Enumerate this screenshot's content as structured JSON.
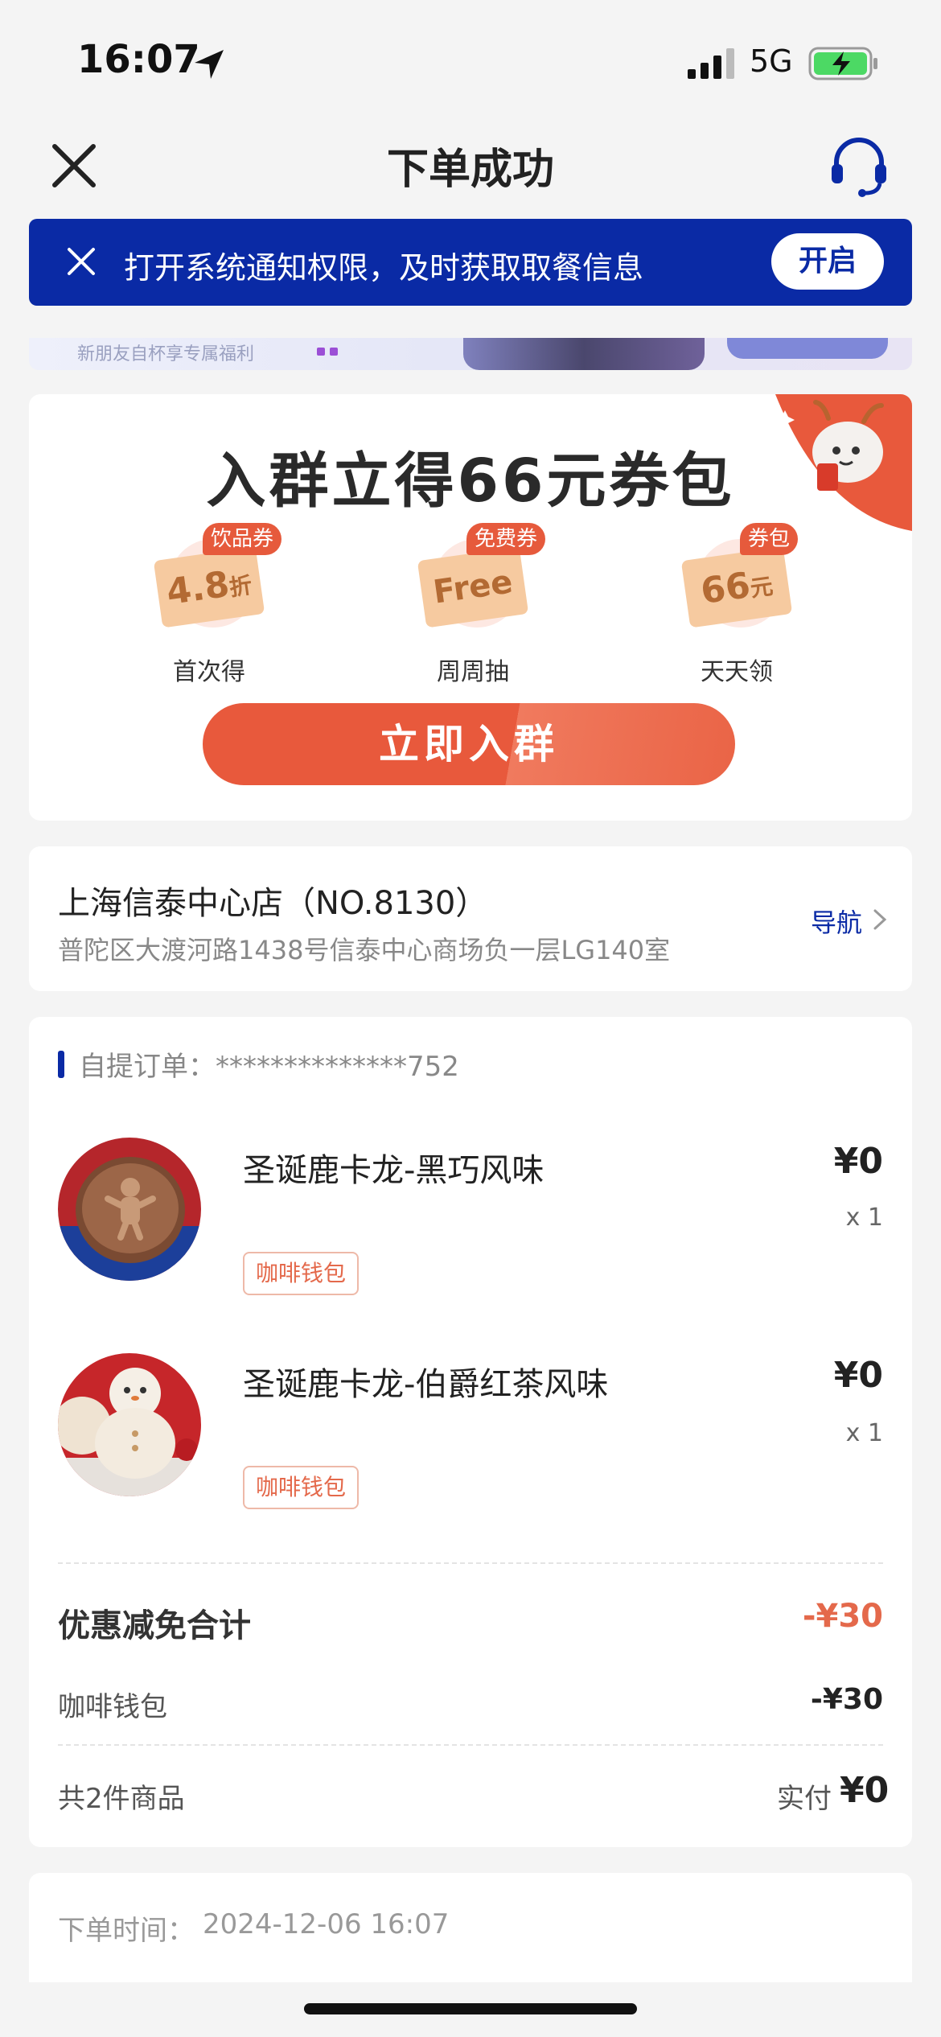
{
  "status": {
    "time": "16:07",
    "network": "5G"
  },
  "header": {
    "title": "下单成功"
  },
  "notice": {
    "text": "打开系统通知权限，及时获取取餐信息",
    "button": "开启"
  },
  "peek_banner": {
    "text": "新朋友自杯享专属福利"
  },
  "group": {
    "title": "入群立得66元券包",
    "coupons": [
      {
        "badge": "饮品券",
        "ticket_main": "4.8",
        "ticket_sub": "折",
        "label": "首次得"
      },
      {
        "badge": "免费券",
        "ticket_main": "Free",
        "ticket_sub": "",
        "label": "周周抽"
      },
      {
        "badge": "券包",
        "ticket_main": "66",
        "ticket_sub": "元",
        "label": "天天领"
      }
    ],
    "join_button": "立即入群"
  },
  "store": {
    "name": "上海信泰中心店（NO.8130）",
    "address": "普陀区大渡河路1438号信泰中心商场负一层LG140室",
    "nav_label": "导航"
  },
  "order": {
    "id_label": "自提订单：",
    "id_value": "**************752",
    "items": [
      {
        "name": "圣诞鹿卡龙-黑巧风味",
        "tag": "咖啡钱包",
        "price": "¥0",
        "qty": "x 1"
      },
      {
        "name": "圣诞鹿卡龙-伯爵红茶风味",
        "tag": "咖啡钱包",
        "price": "¥0",
        "qty": "x 1"
      }
    ],
    "discount_title": "优惠减免合计",
    "discount_total": "-¥30",
    "wallet_label": "咖啡钱包",
    "wallet_value": "-¥30",
    "count_label": "共2件商品",
    "paid_label": "实付",
    "paid_value": "¥0"
  },
  "time_info": {
    "label": "下单时间：",
    "value": "2024-12-06 16:07"
  },
  "colors": {
    "brand_blue": "#0a2aa5",
    "accent_orange": "#e8593c"
  }
}
